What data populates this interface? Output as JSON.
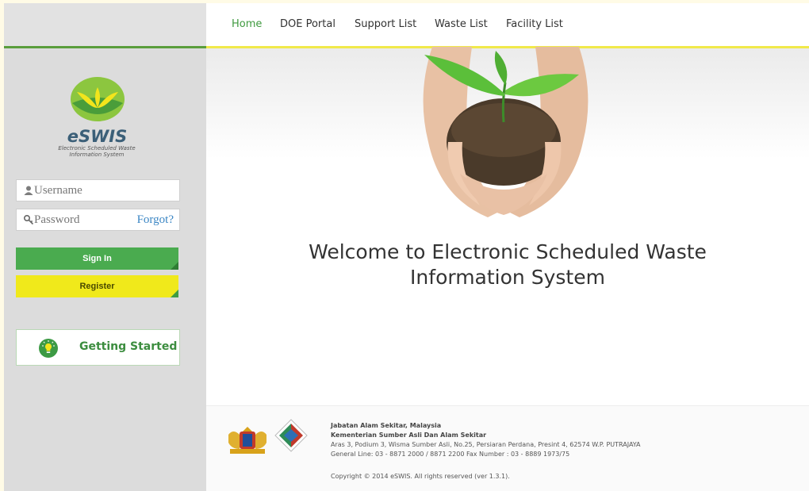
{
  "sidebar": {
    "brand": "eSWIS",
    "brand_sub_line1": "Electronic Scheduled Waste",
    "brand_sub_line2": "Information System",
    "username_placeholder": "Username",
    "password_placeholder": "Password",
    "forgot_label": "Forgot?",
    "signin_label": "Sign In",
    "register_label": "Register",
    "getting_started_label": "Getting Started",
    "icons": [
      "user-icon",
      "key-icon",
      "lightbulb-icon",
      "eswis-logo-icon"
    ]
  },
  "nav": {
    "items": [
      "Home",
      "DOE Portal",
      "Support List",
      "Waste List",
      "Facility List"
    ],
    "active": "Home"
  },
  "main": {
    "welcome_line1": "Welcome to Electronic Scheduled Waste",
    "welcome_line2": "Information System"
  },
  "footer": {
    "org1": "Jabatan Alam Sekitar, Malaysia",
    "org2": "Kementerian Sumber Asli Dan Alam Sekitar",
    "address": "Aras 3, Podium 3, Wisma Sumber Asli, No.25, Persiaran Perdana, Presint 4, 62574 W.P. PUTRAJAYA",
    "phone": "General Line: 03 - 8871 2000 / 8871 2200 Fax Number : 03 - 8889 1973/75",
    "copyright": "Copyright © 2014 eSWIS. All rights reserved (ver 1.3.1)."
  },
  "colors": {
    "accent_green": "#4aab4f",
    "accent_yellow": "#f0e91b",
    "sidebar_bg": "#dcdcdc",
    "link_blue": "#3b86c4"
  }
}
